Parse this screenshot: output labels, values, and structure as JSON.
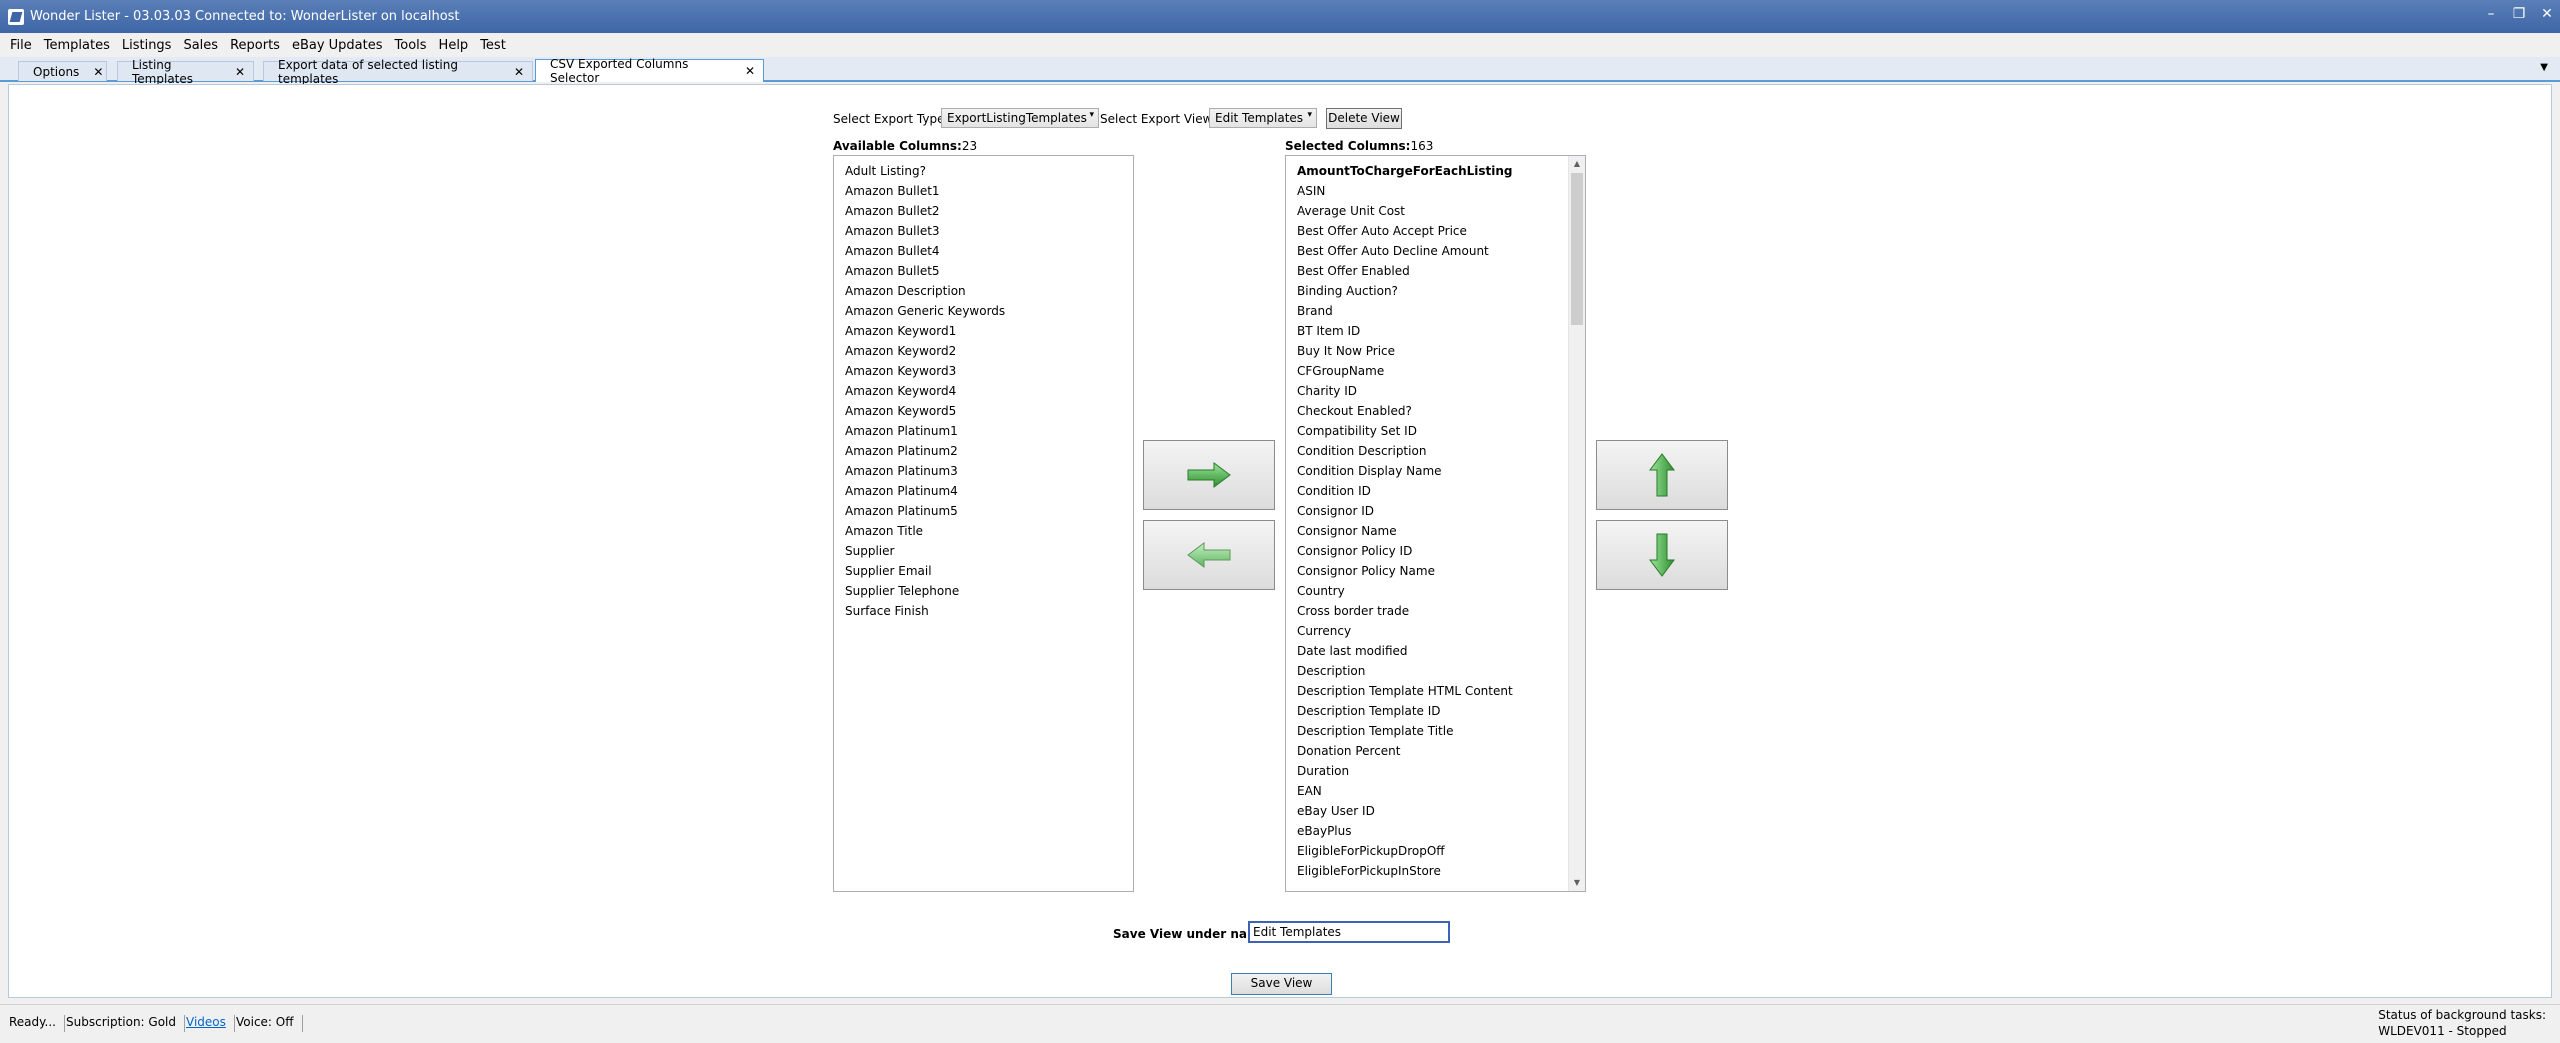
{
  "window": {
    "title": "Wonder Lister - 03.03.03 Connected to: WonderLister on localhost",
    "controls": [
      "–",
      "❐",
      "✕"
    ]
  },
  "menu": [
    "File",
    "Templates",
    "Listings",
    "Sales",
    "Reports",
    "eBay Updates",
    "Tools",
    "Help",
    "Test"
  ],
  "tabs": [
    {
      "label": "Options",
      "close": "✕"
    },
    {
      "label": "Listing Templates",
      "close": "✕"
    },
    {
      "label": "Export data of selected listing templates",
      "close": "✕"
    },
    {
      "label": "CSV Exported Columns Selector",
      "close": "✕",
      "active": true
    }
  ],
  "tab_menu_glyph": "▼",
  "controls": {
    "export_type_label": "Select Export Type:",
    "export_type_value": "ExportListingTemplates",
    "export_view_label": "Select Export View:",
    "export_view_value": "Edit Templates",
    "delete_view": "Delete View",
    "combo_arrow": "▾"
  },
  "available": {
    "label": "Available Columns:",
    "count": "23",
    "items": [
      "Adult Listing?",
      "Amazon Bullet1",
      "Amazon Bullet2",
      "Amazon Bullet3",
      "Amazon Bullet4",
      "Amazon Bullet5",
      "Amazon Description",
      "Amazon Generic Keywords",
      "Amazon Keyword1",
      "Amazon Keyword2",
      "Amazon Keyword3",
      "Amazon Keyword4",
      "Amazon Keyword5",
      "Amazon Platinum1",
      "Amazon Platinum2",
      "Amazon Platinum3",
      "Amazon Platinum4",
      "Amazon Platinum5",
      "Amazon Title",
      "Supplier",
      "Supplier Email",
      "Supplier Telephone",
      "Surface Finish"
    ]
  },
  "selected": {
    "label": "Selected Columns:",
    "count": "163",
    "items": [
      "AmountToChargeForEachListing",
      "ASIN",
      "Average Unit Cost",
      "Best Offer Auto Accept Price",
      "Best Offer Auto Decline Amount",
      "Best Offer Enabled",
      "Binding Auction?",
      "Brand",
      "BT Item ID",
      "Buy It Now Price",
      "CFGroupName",
      "Charity ID",
      "Checkout Enabled?",
      "Compatibility Set ID",
      "Condition Description",
      "Condition Display Name",
      "Condition ID",
      "Consignor ID",
      "Consignor Name",
      "Consignor Policy ID",
      "Consignor Policy Name",
      "Country",
      "Cross border trade",
      "Currency",
      "Date last modified",
      "Description",
      "Description Template HTML Content",
      "Description Template ID",
      "Description Template Title",
      "Donation Percent",
      "Duration",
      "EAN",
      "eBay User ID",
      "eBayPlus",
      "EligibleForPickupDropOff",
      "EligibleForPickupInStore"
    ],
    "scroll_up": "▲",
    "scroll_down": "▼"
  },
  "colors": {
    "arrow_green": "#3aa63a",
    "accent": "#3c63b5"
  },
  "save": {
    "label": "Save View under name:",
    "value": "Edit Templates",
    "button": "Save View"
  },
  "status": {
    "ready": "Ready...",
    "subscription": "Subscription: Gold",
    "videos": "Videos",
    "voice": "Voice:  Off",
    "bg_title": "Status of background tasks:",
    "bg_value": "WLDEV011 - Stopped"
  }
}
